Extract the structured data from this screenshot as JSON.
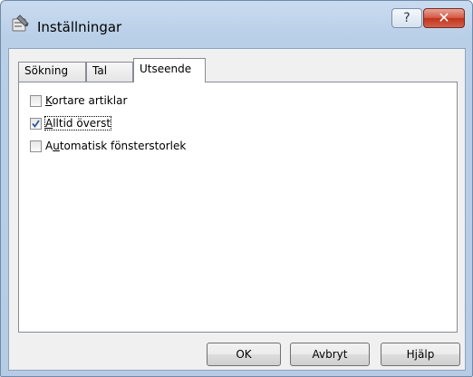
{
  "window": {
    "title": "Inställningar",
    "help_glyph": "?",
    "close_glyph": "✕"
  },
  "tabs": [
    {
      "label": "Sökning",
      "selected": false
    },
    {
      "label": "Tal",
      "selected": false
    },
    {
      "label": "Utseende",
      "selected": true
    }
  ],
  "options": [
    {
      "pre": "",
      "mnemonic": "K",
      "post": "ortare artiklar",
      "checked": false
    },
    {
      "pre": "",
      "mnemonic": "A",
      "post": "lltid överst",
      "checked": true
    },
    {
      "pre": "A",
      "mnemonic": "u",
      "post": "tomatisk fönsterstorlek",
      "checked": false
    }
  ],
  "buttons": {
    "ok": "OK",
    "cancel": "Avbryt",
    "help": "Hjälp"
  },
  "colors": {
    "close_red": "#c2321b",
    "check_blue": "#2b5a9e"
  }
}
